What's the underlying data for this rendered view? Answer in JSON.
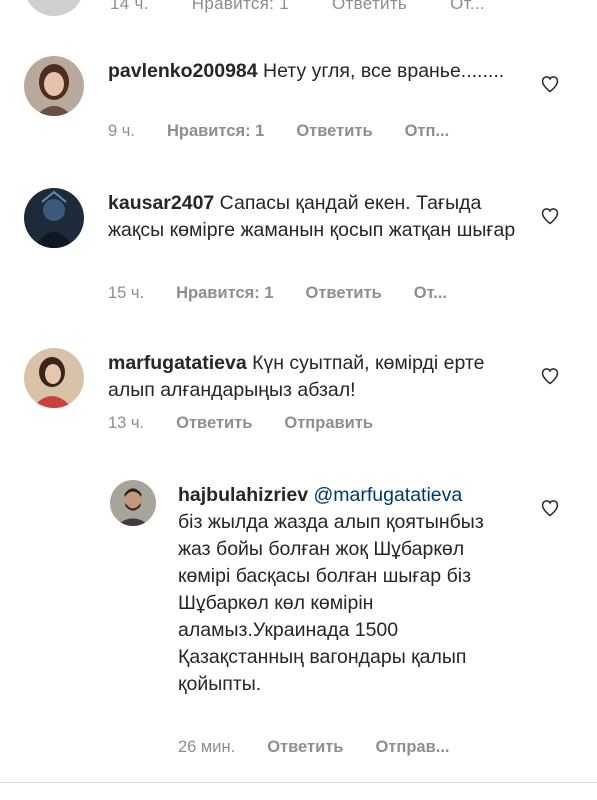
{
  "partial_comment": {
    "time": "14 ч.",
    "likes": "Нравится: 1",
    "reply": "Ответить",
    "send": "От..."
  },
  "comments": [
    {
      "username": "pavlenko200984",
      "text": " Нету угля, все враньe........",
      "time": "9 ч.",
      "likes": "Нравится: 1",
      "reply": "Ответить",
      "send": "Отп..."
    },
    {
      "username": "kausar2407",
      "text": " Сапасы қандай екен. Тағыда жақсы көмірге жаманын қосып жатқан шығар",
      "time": "15 ч.",
      "likes": "Нравится: 1",
      "reply": "Ответить",
      "send": "От..."
    },
    {
      "username": "marfugatatieva",
      "text": " Күн суытпай, көмірді ерте алып алғандарыңыз абзал!",
      "time": "13 ч.",
      "reply": "Ответить",
      "send": "Отправить"
    },
    {
      "username": "hajbulahizriev",
      "mention": " @marfugatatieva",
      "text": "біз жылда жазда алып қоятынбыз жаз бойы болған жоқ Шұбаркөл көмірі басқасы болған шығар біз Шұбаркөл көл көмірін аламыз.Украинада 1500 Қазақстанның вагондары қалып қойыпты.",
      "time": "26 мин.",
      "reply": "Ответить",
      "send": "Отправ..."
    }
  ],
  "colors": {
    "text": "#262626",
    "meta": "#8e8e8e",
    "mention": "#00376b",
    "divider": "#dbdbdb"
  },
  "icons": {
    "like": "heart-outline-icon"
  }
}
